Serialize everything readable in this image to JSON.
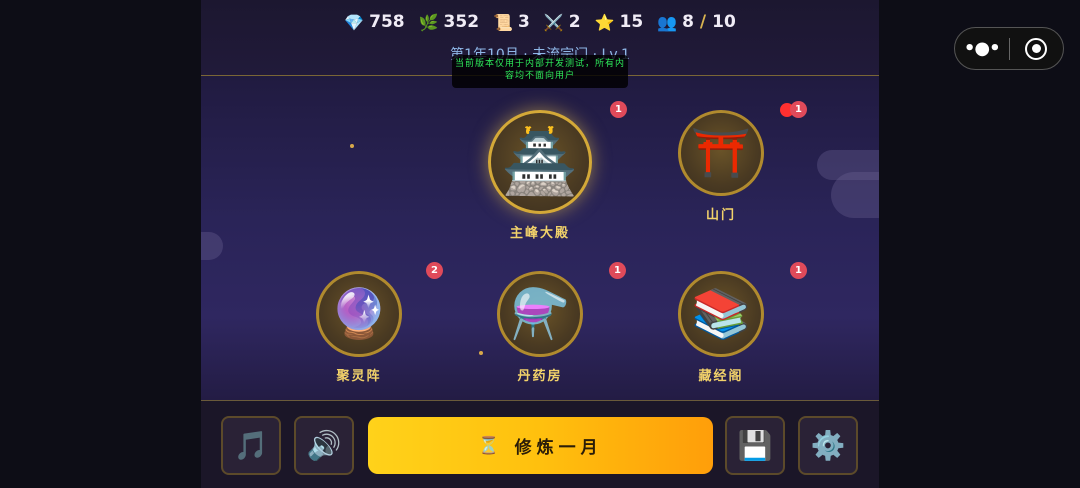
{
  "stats": {
    "gems": "758",
    "herbs": "352",
    "scrolls": "3",
    "swords": "2",
    "stars": "15",
    "disciples": "8",
    "disciples_max": "10",
    "gem_icon": "💎",
    "herb_icon": "🌿",
    "scroll_icon": "📜",
    "sword_icon": "⚔️",
    "star_icon": "⭐",
    "people_icon": "👥",
    "separator": "/"
  },
  "subtitle": "第1年10月 · 未流宗门 · Lv.1",
  "notice": "当前版本仅用于内部开发测试，所有内容均不面向用户",
  "buildings": [
    {
      "name": "主峰大殿",
      "icon": "🏯",
      "badge": "1"
    },
    {
      "name": "山门",
      "icon": "⛩️",
      "badge": "1"
    },
    {
      "name": "聚灵阵",
      "icon": "🔮",
      "badge": "2"
    },
    {
      "name": "丹药房",
      "icon": "⚗️",
      "badge": "1"
    },
    {
      "name": "藏经阁",
      "icon": "📚",
      "badge": "1"
    }
  ],
  "bottom": {
    "music_icon": "🎵",
    "sound_icon": "🔊",
    "cultivate_icon": "⏳",
    "cultivate_label": "修炼一月",
    "save_icon": "💾",
    "settings_icon": "⚙️"
  },
  "capsule": {
    "menu_glyph": "•●•"
  },
  "colors": {
    "accent_gold": "#d4a938",
    "label_gold": "#f2d26a",
    "badge_red": "#e04a5a",
    "notice_green": "#2ee85a",
    "button_yellow": "#ffc00e"
  }
}
